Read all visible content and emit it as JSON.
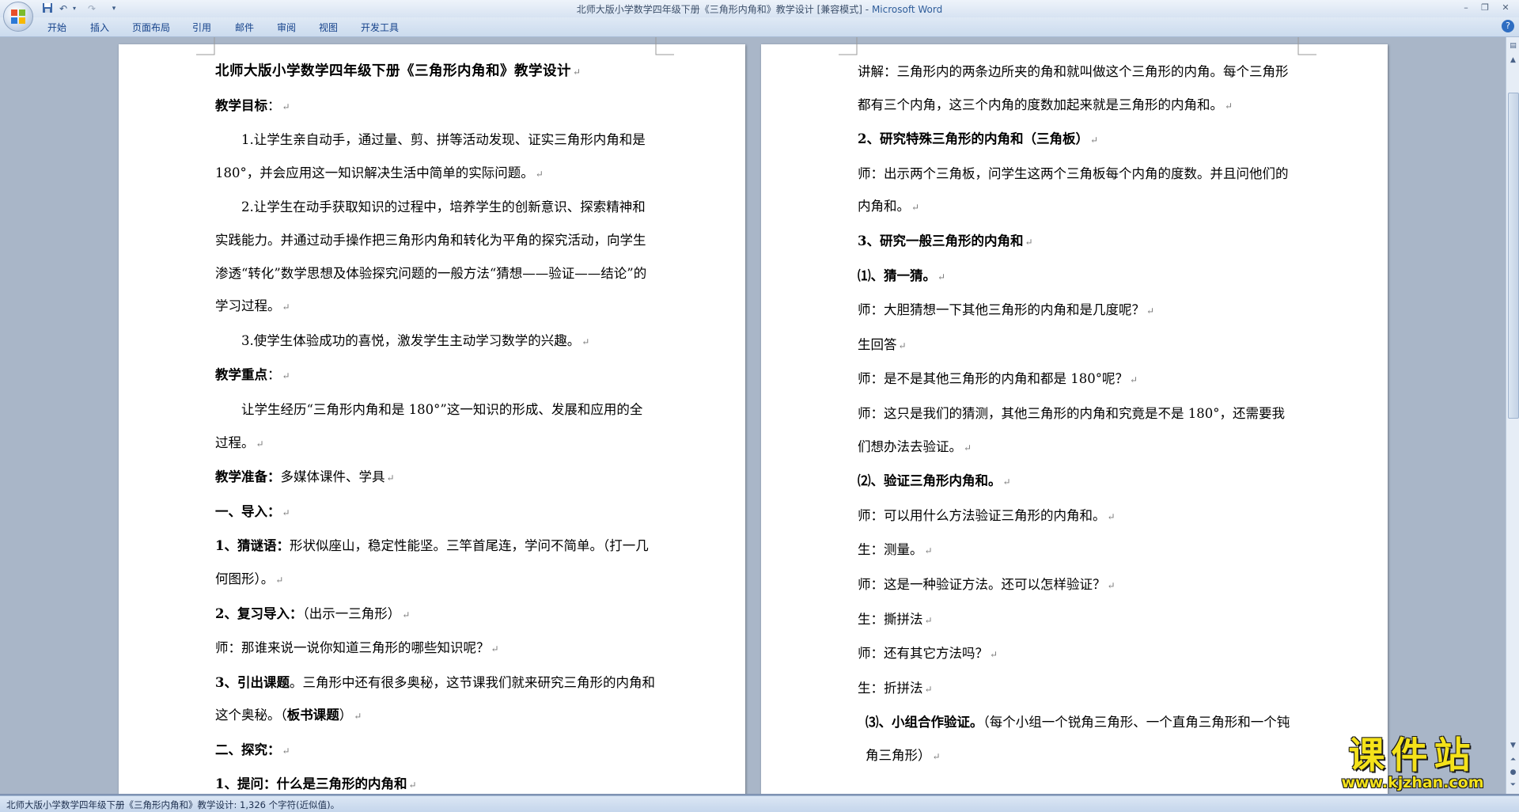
{
  "window": {
    "title": "北师大版小学数学四年级下册《三角形内角和》教学设计 [兼容模式]",
    "title_sep": " - ",
    "app_name": "Microsoft Word"
  },
  "ribbon": {
    "tabs": [
      "开始",
      "插入",
      "页面布局",
      "引用",
      "邮件",
      "审阅",
      "视图",
      "开发工具"
    ]
  },
  "colors": {
    "accent": "#2f5d9a",
    "watermark": "#f4e21a"
  },
  "icons": [
    "office-button-icon",
    "save-icon",
    "undo-icon",
    "redo-icon",
    "customize-qat-icon",
    "help-icon",
    "minimize-icon",
    "restore-icon",
    "close-icon"
  ],
  "page_left": {
    "paragraphs": [
      {
        "runs": [
          {
            "t": "北师大版小学数学四年级下册《三角形内角和》教学设计"
          }
        ]
      },
      {
        "runs": [
          {
            "t": "教学目标",
            "b": true
          },
          {
            "t": "："
          }
        ]
      },
      {
        "runs": [
          {
            "t": "1.让学生亲自动手，通过量、剪、拼等活动发现、证实三角形内角和是 180°，并会应用这一知识解决生活中简单的实际问题。"
          }
        ]
      },
      {
        "runs": [
          {
            "t": "2.让学生在动手获取知识的过程中，培养学生的创新意识、探索精神和实践能力。并通过动手操作把三角形内角和转化为平角的探究活动，向学生渗透“转化”数学思想及体验探究问题的一般方法“猜想——验证——结论”的学习过程。"
          }
        ]
      },
      {
        "runs": [
          {
            "t": "3.使学生体验成功的喜悦，激发学生主动学习数学的兴趣。"
          }
        ]
      },
      {
        "runs": [
          {
            "t": "教学重点",
            "b": true
          },
          {
            "t": "："
          }
        ]
      },
      {
        "runs": [
          {
            "t": "让学生经历“三角形内角和是 180°”这一知识的形成、发展和应用的全过程。"
          }
        ]
      },
      {
        "runs": [
          {
            "t": "教学准备：",
            "b": true
          },
          {
            "t": "多媒体课件、学具"
          }
        ]
      },
      {
        "runs": [
          {
            "t": "一、导入：",
            "b": true
          }
        ]
      },
      {
        "runs": [
          {
            "t": "1、猜谜语：",
            "b": true
          },
          {
            "t": "形状似座山，稳定性能坚。三竿首尾连，学问不简单。（打一几何图形）。"
          }
        ]
      },
      {
        "runs": [
          {
            "t": "2、复习导入：",
            "b": true
          },
          {
            "t": "（出示一三角形）"
          }
        ]
      },
      {
        "runs": [
          {
            "t": "师：那谁来说一说你知道三角形的哪些知识呢？"
          }
        ]
      },
      {
        "runs": [
          {
            "t": "3、引出课题",
            "b": true
          },
          {
            "t": "。三角形中还有很多奥秘，这节课我们就来研究三角形的内角和这个奥秘。（"
          },
          {
            "t": "板书课题",
            "b": true
          },
          {
            "t": "）"
          }
        ]
      },
      {
        "runs": [
          {
            "t": "二、探究：",
            "b": true
          }
        ]
      },
      {
        "runs": [
          {
            "t": "1、提问：什么是三角形的内角和",
            "b": true
          }
        ]
      }
    ]
  },
  "page_right": {
    "paragraphs": [
      {
        "runs": [
          {
            "t": "讲解：三角形内的两条边所夹的角和就叫做这个三角形的内角。每个三角形都有三个内角，这三个内角的度数加起来就是三角形的内角和。"
          }
        ]
      },
      {
        "runs": [
          {
            "t": "2、研究特殊三角形的内角和（三角板）",
            "b": true
          }
        ]
      },
      {
        "runs": [
          {
            "t": "师：出示两个三角板，问学生这两个三角板每个内角的度数。并且问他们的内角和。"
          }
        ]
      },
      {
        "runs": [
          {
            "t": "3、研究一般三角形的内角和",
            "b": true
          }
        ]
      },
      {
        "runs": [
          {
            "t": "⑴、猜一猜。",
            "b": true
          }
        ]
      },
      {
        "runs": [
          {
            "t": "师：大胆猜想一下其他三角形的内角和是几度呢？"
          }
        ]
      },
      {
        "runs": [
          {
            "t": "生回答"
          }
        ]
      },
      {
        "runs": [
          {
            "t": "师：是不是其他三角形的内角和都是 180°呢？"
          }
        ]
      },
      {
        "runs": [
          {
            "t": "师：这只是我们的猜测，其他三角形的内角和究竟是不是 180°，还需要我们想办法去验证。"
          }
        ]
      },
      {
        "runs": [
          {
            "t": "⑵、验证三角形内角和。",
            "b": true
          }
        ]
      },
      {
        "runs": [
          {
            "t": "师：可以用什么方法验证三角形的内角和。"
          }
        ]
      },
      {
        "runs": [
          {
            "t": "生：测量。"
          }
        ]
      },
      {
        "runs": [
          {
            "t": "师：这是一种验证方法。还可以怎样验证？"
          }
        ]
      },
      {
        "runs": [
          {
            "t": "生：撕拼法"
          }
        ]
      },
      {
        "runs": [
          {
            "t": "师：还有其它方法吗？"
          }
        ]
      },
      {
        "runs": [
          {
            "t": "生：折拼法"
          }
        ]
      },
      {
        "runs": [
          {
            "t": "⑶、小组合作验证。",
            "b": true
          },
          {
            "t": "（每个小组一个锐角三角形、一个直角三角形和一个钝角三角形）"
          }
        ]
      }
    ]
  },
  "statusbar": {
    "text": "北师大版小学数学四年级下册《三角形内角和》教学设计: 1,326 个字符(近似值)。"
  },
  "watermark": {
    "title": "课件站",
    "url": "www.kjzhan.com"
  }
}
